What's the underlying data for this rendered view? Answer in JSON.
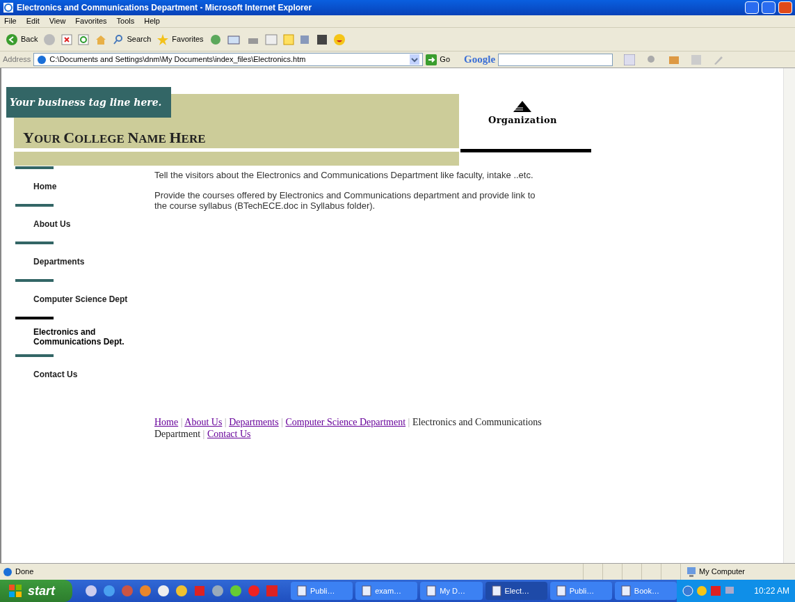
{
  "window": {
    "title": "Electronics and Communications Department - Microsoft Internet Explorer"
  },
  "menu": [
    "File",
    "Edit",
    "View",
    "Favorites",
    "Tools",
    "Help"
  ],
  "toolbar": {
    "back": "Back",
    "search": "Search",
    "favorites": "Favorites"
  },
  "address_bar": {
    "label": "Address",
    "value": "C:\\Documents and Settings\\dnm\\My Documents\\index_files\\Electronics.htm",
    "go": "Go",
    "google": "Google"
  },
  "page": {
    "tagline": "Your business tag line here.",
    "college_name": "YOUR COLLEGE NAME HERE",
    "footer_separator": "|",
    "logo_text": "Organization",
    "nav": [
      {
        "label": "Home",
        "selected": false
      },
      {
        "label": "About Us",
        "selected": false
      },
      {
        "label": "Departments",
        "selected": false
      },
      {
        "label": "Computer Science Dept",
        "selected": false
      },
      {
        "label": "Electronics and Communications Dept.",
        "selected": true
      },
      {
        "label": "Contact Us",
        "selected": false
      }
    ],
    "paragraphs": [
      "Tell the visitors about the Electronics and Communications Department like faculty, intake ..etc.",
      "Provide the courses offered by Electronics and Communications department and provide link to the course syllabus (BTechECE.doc in Syllabus folder)."
    ],
    "footer_links": [
      {
        "label": "Home",
        "kind": "link"
      },
      {
        "label": "About Us",
        "kind": "link"
      },
      {
        "label": "Departments",
        "kind": "link"
      },
      {
        "label": "Computer Science Department",
        "kind": "link"
      },
      {
        "label": "Electronics and Communications Department",
        "kind": "current"
      },
      {
        "label": "Contact Us",
        "kind": "link"
      }
    ]
  },
  "status_bar": {
    "text": "Done",
    "zone": "My Computer"
  },
  "taskbar": {
    "start": "start",
    "tasks": [
      {
        "label": "Publi…",
        "selected": false
      },
      {
        "label": "exam…",
        "selected": false
      },
      {
        "label": "My D…",
        "selected": false
      },
      {
        "label": "Elect…",
        "selected": true
      },
      {
        "label": "Publi…",
        "selected": false
      },
      {
        "label": "Book…",
        "selected": false
      }
    ],
    "clock": "10:22 AM"
  }
}
